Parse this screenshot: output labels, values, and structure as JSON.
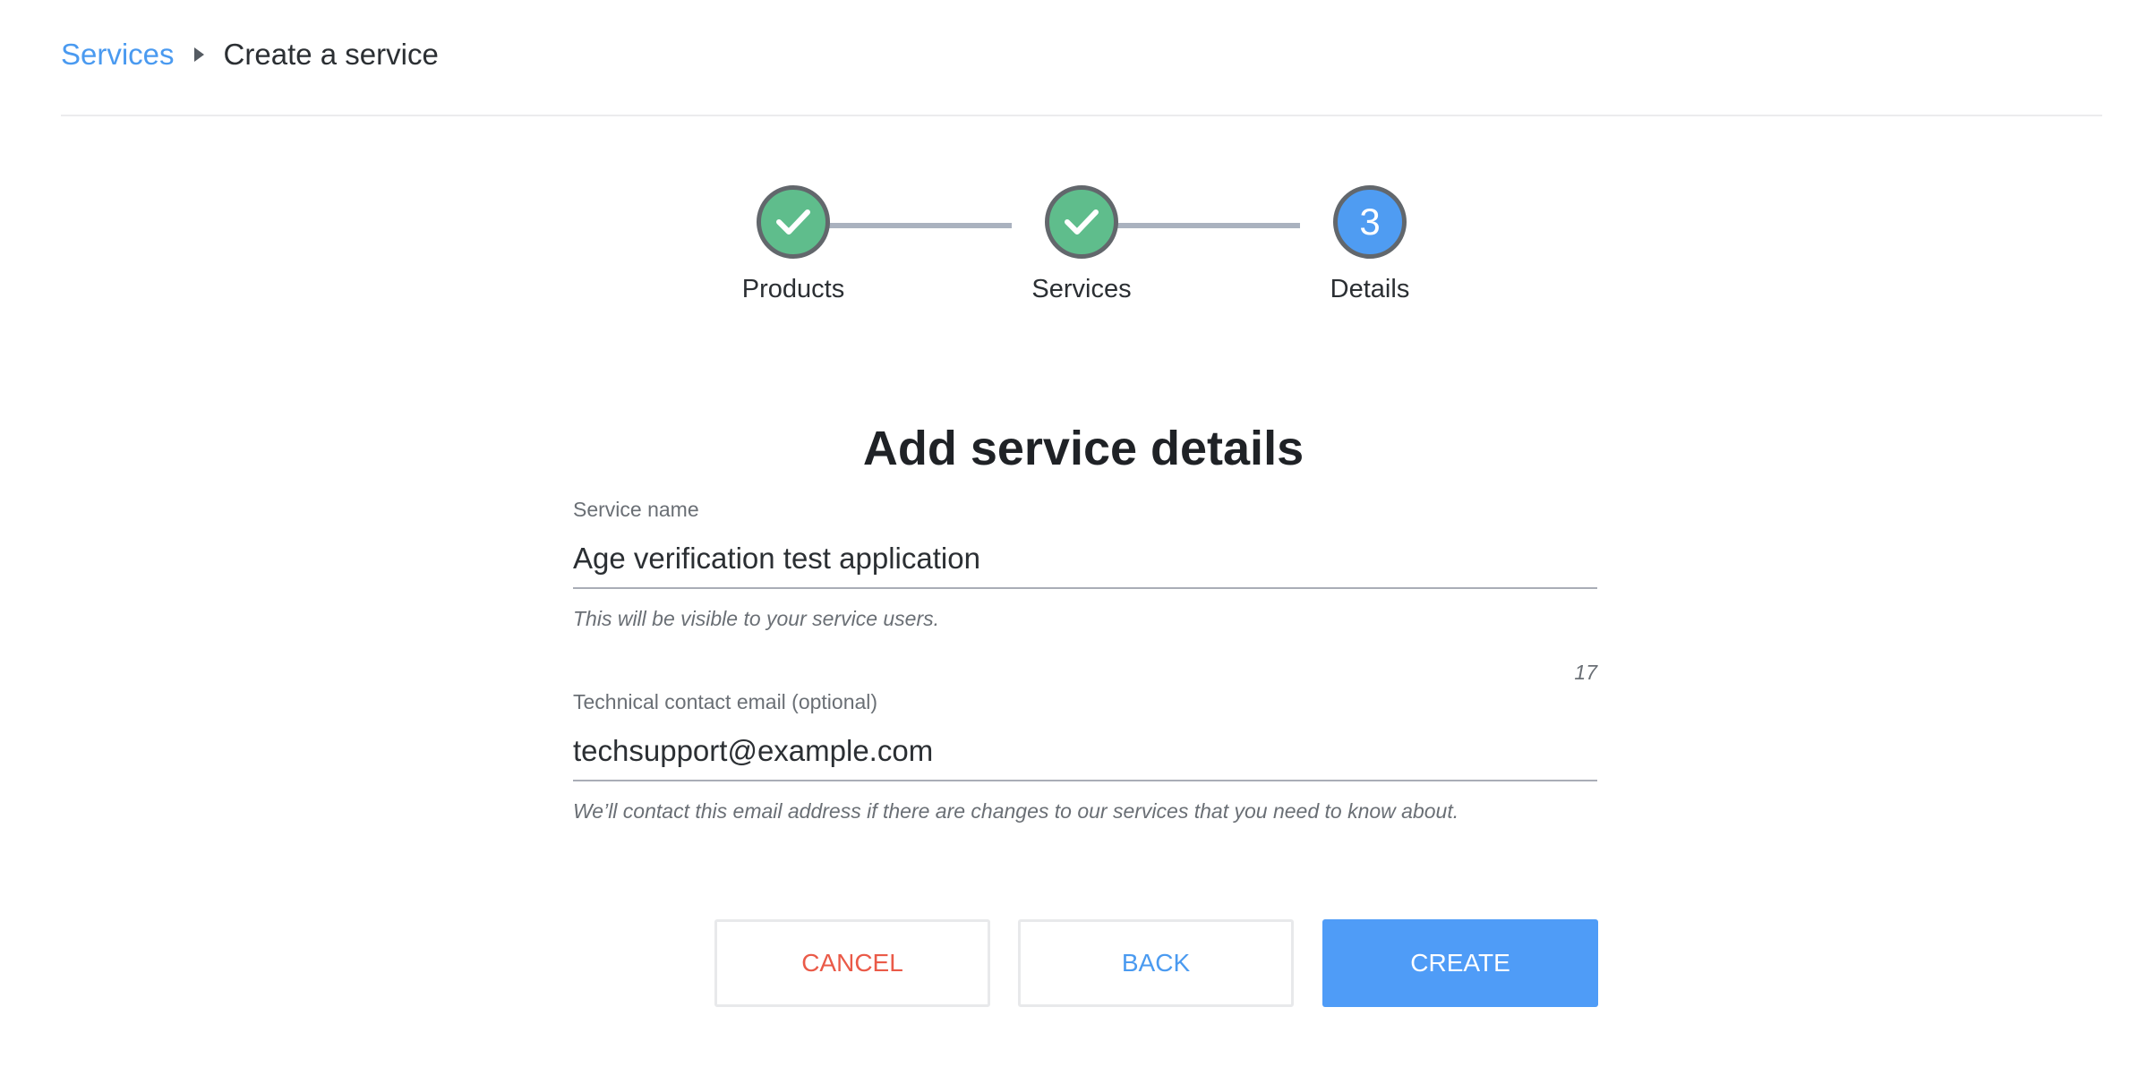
{
  "breadcrumb": {
    "parent": "Services",
    "current": "Create a service"
  },
  "stepper": {
    "steps": [
      {
        "label": "Products",
        "state": "complete",
        "icon": "check-icon"
      },
      {
        "label": "Services",
        "state": "complete",
        "icon": "check-icon"
      },
      {
        "label": "Details",
        "state": "active",
        "number": "3"
      }
    ]
  },
  "form": {
    "title": "Add service details",
    "service_name": {
      "label": "Service name",
      "value": "Age verification test application",
      "hint": "This will be visible to your service users.",
      "char_count": "17"
    },
    "tech_email": {
      "label": "Technical contact email (optional)",
      "value": "techsupport@example.com",
      "hint": "We’ll contact this email address if there are changes to our services that you need to know about."
    }
  },
  "actions": {
    "cancel_label": "CANCEL",
    "back_label": "BACK",
    "create_label": "CREATE"
  },
  "colors": {
    "accent": "#4f9cf7",
    "link": "#4a9af0",
    "danger": "#ea5a48",
    "step_complete": "#5fbd8c"
  }
}
